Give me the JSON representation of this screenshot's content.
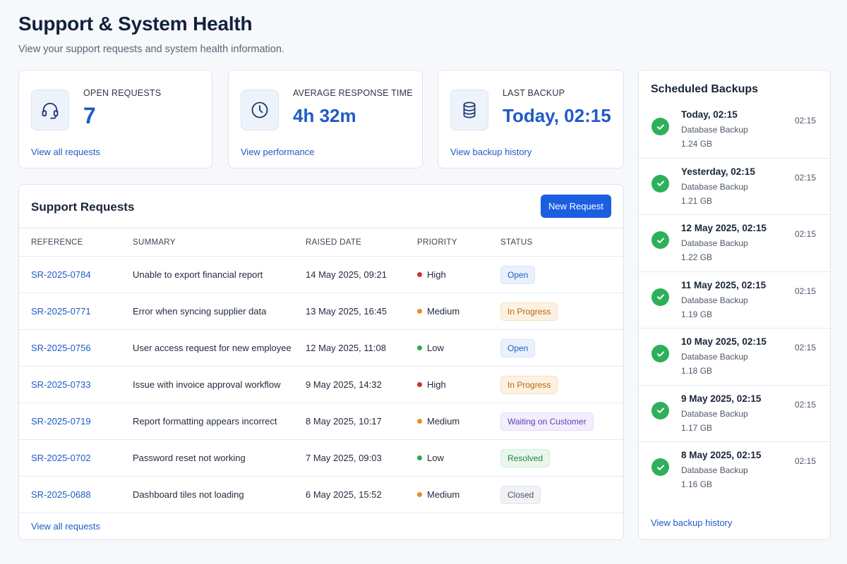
{
  "header": {
    "title": "Support & System Health",
    "subtitle": "View your support requests and system health information."
  },
  "stats": [
    {
      "label": "OPEN REQUESTS",
      "value": "7",
      "link": "View all requests",
      "icon": "headset-icon"
    },
    {
      "label": "AVERAGE RESPONSE TIME",
      "value": "4h 32m",
      "link": "View performance",
      "icon": "clock-icon"
    },
    {
      "label": "LAST BACKUP",
      "value": "Today, 02:15",
      "link": "View backup history",
      "icon": "database-icon"
    }
  ],
  "requests": {
    "title": "Support Requests",
    "new_button": "New Request",
    "columns": [
      "REFERENCE",
      "SUMMARY",
      "RAISED DATE",
      "PRIORITY",
      "STATUS"
    ],
    "rows": [
      {
        "ref": "SR-2025-0784",
        "summary": "Unable to export financial report",
        "date": "14 May 2025, 09:21",
        "priority": "High",
        "status": "Open"
      },
      {
        "ref": "SR-2025-0771",
        "summary": "Error when syncing supplier data",
        "date": "13 May 2025, 16:45",
        "priority": "Medium",
        "status": "In Progress"
      },
      {
        "ref": "SR-2025-0756",
        "summary": "User access request for new employee",
        "date": "12 May 2025, 11:08",
        "priority": "Low",
        "status": "Open"
      },
      {
        "ref": "SR-2025-0733",
        "summary": "Issue with invoice approval workflow",
        "date": "9 May 2025, 14:32",
        "priority": "High",
        "status": "In Progress"
      },
      {
        "ref": "SR-2025-0719",
        "summary": "Report formatting appears incorrect",
        "date": "8 May 2025, 10:17",
        "priority": "Medium",
        "status": "Waiting on Customer"
      },
      {
        "ref": "SR-2025-0702",
        "summary": "Password reset not working",
        "date": "7 May 2025, 09:03",
        "priority": "Low",
        "status": "Resolved"
      },
      {
        "ref": "SR-2025-0688",
        "summary": "Dashboard tiles not loading",
        "date": "6 May 2025, 15:52",
        "priority": "Medium",
        "status": "Closed"
      }
    ],
    "footer_link": "View all requests"
  },
  "priority_colors": {
    "High": "#d62f2f",
    "Medium": "#f08a24",
    "Low": "#2eaa55"
  },
  "status_styles": {
    "Open": {
      "bg": "#eaf1fd",
      "fg": "#1f5bc6",
      "border": "#d6e3f9"
    },
    "In Progress": {
      "bg": "#fdf1e2",
      "fg": "#b7650f",
      "border": "#f6e0c2"
    },
    "Waiting on Customer": {
      "bg": "#f2eefd",
      "fg": "#5b3fb6",
      "border": "#e4dcf8"
    },
    "Resolved": {
      "bg": "#e9f6ec",
      "fg": "#23843f",
      "border": "#d3ecd9"
    },
    "Closed": {
      "bg": "#f0f2f5",
      "fg": "#4a5465",
      "border": "#e2e6ec"
    }
  },
  "backups": {
    "title": "Scheduled Backups",
    "items": [
      {
        "when": "Today, 02:15",
        "type": "Database Backup",
        "size": "1.24 GB",
        "time": "02:15"
      },
      {
        "when": "Yesterday, 02:15",
        "type": "Database Backup",
        "size": "1.21 GB",
        "time": "02:15"
      },
      {
        "when": "12 May 2025, 02:15",
        "type": "Database Backup",
        "size": "1.22 GB",
        "time": "02:15"
      },
      {
        "when": "11 May 2025, 02:15",
        "type": "Database Backup",
        "size": "1.19 GB",
        "time": "02:15"
      },
      {
        "when": "10 May 2025, 02:15",
        "type": "Database Backup",
        "size": "1.18 GB",
        "time": "02:15"
      },
      {
        "when": "9 May 2025, 02:15",
        "type": "Database Backup",
        "size": "1.17 GB",
        "time": "02:15"
      },
      {
        "when": "8 May 2025, 02:15",
        "type": "Database Backup",
        "size": "1.16 GB",
        "time": "02:15"
      }
    ],
    "footer_link": "View backup history"
  }
}
